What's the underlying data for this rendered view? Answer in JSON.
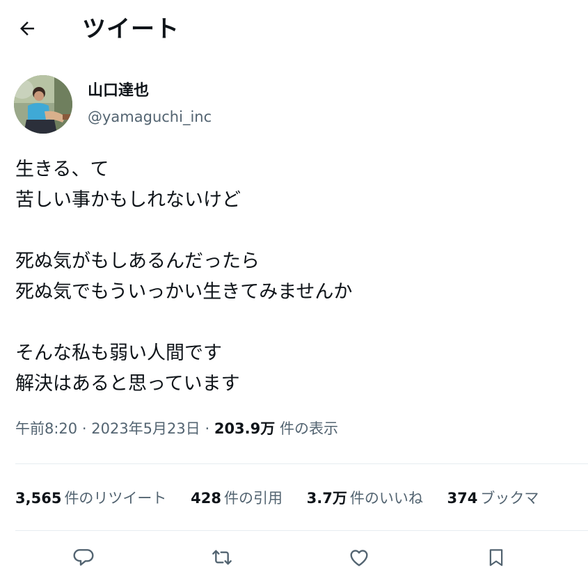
{
  "header": {
    "title": "ツイート",
    "back_icon": "arrow-left-icon"
  },
  "author": {
    "name": "山口達也",
    "handle": "@yamaguchi_inc"
  },
  "tweet": {
    "lines": [
      "生きる、て",
      "苦しい事かもしれないけど",
      "",
      "死ぬ気がもしあるんだったら",
      "死ぬ気でもういっかい生きてみませんか",
      "",
      "そんな私も弱い人間です",
      "解決はあると思っています"
    ]
  },
  "meta": {
    "time": "午前8:20",
    "separator": "·",
    "date": "2023年5月23日",
    "views_count": "203.9万",
    "views_label": "件の表示"
  },
  "stats": {
    "retweets_count": "3,565",
    "retweets_label": "件のリツイート",
    "quotes_count": "428",
    "quotes_label": "件の引用",
    "likes_count": "3.7万",
    "likes_label": "件のいいね",
    "bookmarks_count": "374",
    "bookmarks_label": "ブックマ"
  },
  "actions": {
    "reply_icon": "reply-icon",
    "retweet_icon": "retweet-icon",
    "like_icon": "heart-icon",
    "bookmark_icon": "bookmark-icon"
  },
  "colors": {
    "text_primary": "#0f1419",
    "text_secondary": "#536471",
    "divider": "#e6ecf0",
    "background": "#ffffff"
  }
}
